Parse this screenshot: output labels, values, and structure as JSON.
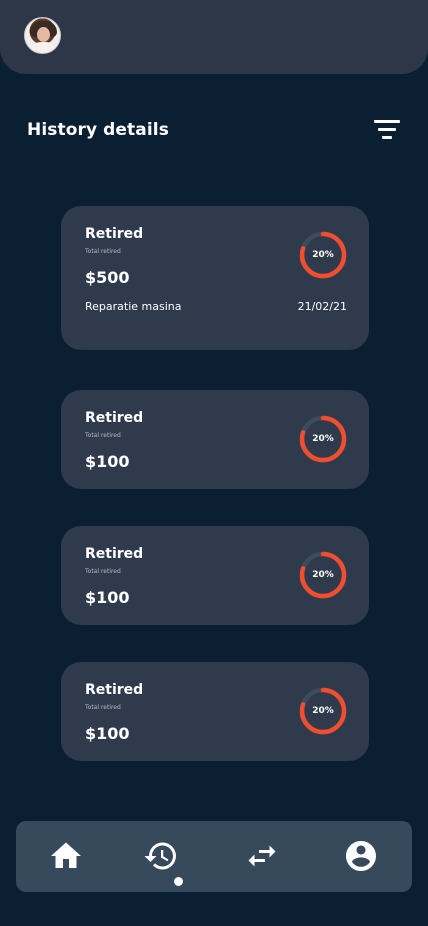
{
  "header": {
    "avatar_alt": "user avatar"
  },
  "page": {
    "title": "History details"
  },
  "cards": [
    {
      "title": "Retired",
      "subtitle": "Total retired",
      "amount": "$500",
      "description": "Reparatie masina",
      "date": "21/02/21",
      "percent_label": "20%",
      "progress": 0.8
    },
    {
      "title": "Retired",
      "subtitle": "Total retired",
      "amount": "$100",
      "percent_label": "20%",
      "progress": 0.8
    },
    {
      "title": "Retired",
      "subtitle": "Total retired",
      "amount": "$100",
      "percent_label": "20%",
      "progress": 0.8
    },
    {
      "title": "Retired",
      "subtitle": "Total retired",
      "amount": "$100",
      "percent_label": "20%",
      "progress": 0.8
    }
  ],
  "nav": {
    "items": [
      {
        "icon": "home-icon",
        "active": false
      },
      {
        "icon": "history-icon",
        "active": true
      },
      {
        "icon": "transfer-icon",
        "active": false
      },
      {
        "icon": "account-icon",
        "active": false
      }
    ]
  },
  "colors": {
    "background": "#0b1f33",
    "card": "#2f3a4c",
    "accent": "#f04e2e",
    "ring_track": "#3d4b5e",
    "navbar": "#374a5c"
  }
}
